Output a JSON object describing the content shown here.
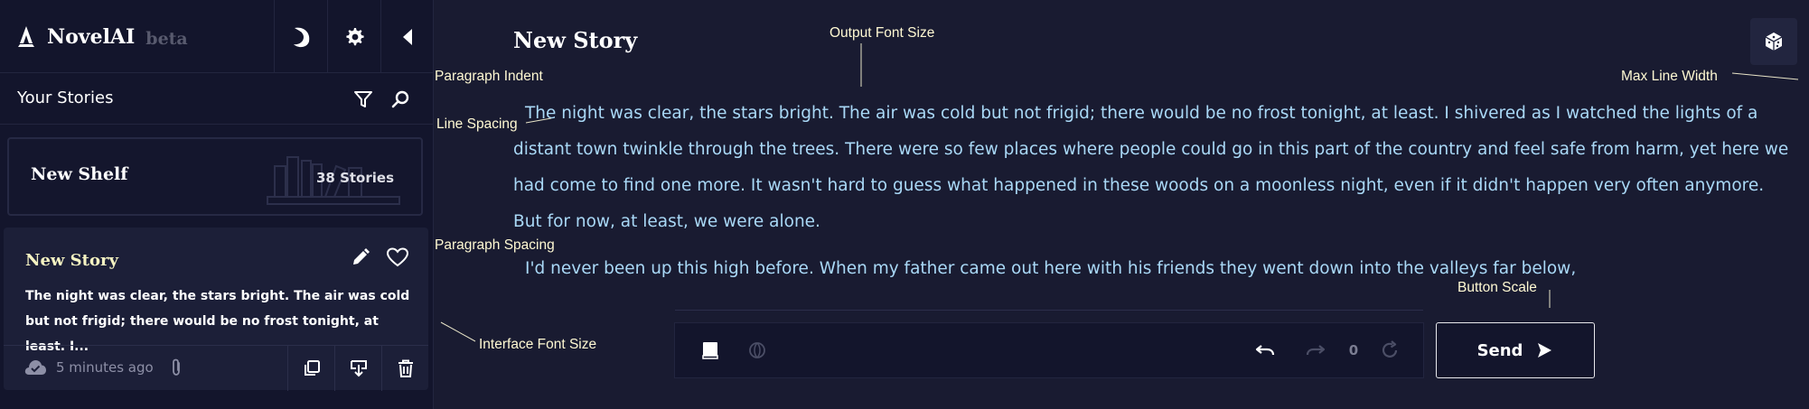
{
  "app": {
    "name": "NovelAI",
    "badge": "beta"
  },
  "sidebar": {
    "header_buttons": [
      "book-logo-icon",
      "gear-icon",
      "collapse-left-icon"
    ],
    "stories_title": "Your Stories",
    "shelf": {
      "name": "New Shelf",
      "count_label": "38 Stories"
    },
    "story_card": {
      "title": "New Story",
      "excerpt": "The night was clear, the stars bright. The air was cold but not frigid; there would be no frost tonight, at least. I...",
      "time": "5 minutes ago"
    }
  },
  "main": {
    "title": "New Story",
    "paragraphs": [
      "The night was clear, the stars bright. The air was cold but not frigid; there would be no frost tonight, at least. I shivered as I watched the lights of a distant town twinkle through the trees. There were so few places where people could go in this part of the country and feel safe from harm, yet here we had come to find one more. It wasn't hard to guess what happened in these woods on a moonless night, even if it didn't happen very often anymore.",
      "But for now, at least, we were alone.",
      "I'd never been up this high before. When my father came out here with his friends they went down into the valleys far below,"
    ],
    "undo_count": "0",
    "send_label": "Send"
  },
  "annotations": {
    "output_font_size": "Output Font Size",
    "paragraph_indent": "Paragraph Indent",
    "max_line_width": "Max Line Width",
    "line_spacing": "Line Spacing",
    "paragraph_spacing": "Paragraph Spacing",
    "button_scale": "Button Scale",
    "interface_font_size": "Interface Font Size"
  },
  "colors": {
    "background": "#191b31",
    "sidebar": "#13152c",
    "story_text": "#a9d8f6",
    "title_accent": "#f5f3c2",
    "annotation": "#fff9d3"
  }
}
